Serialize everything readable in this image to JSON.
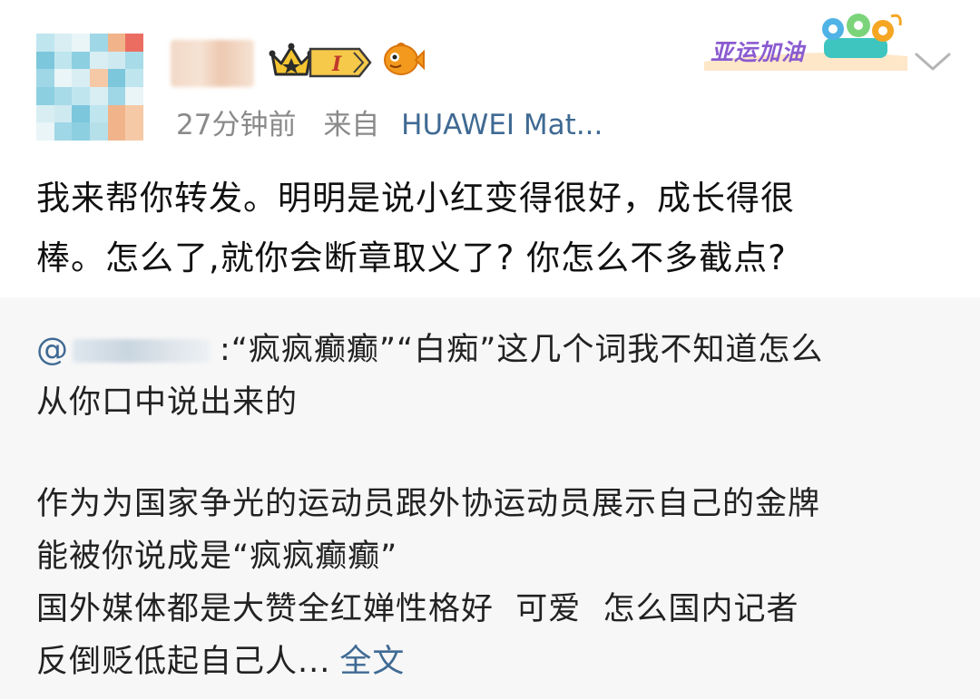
{
  "header": {
    "time_ago": "27分钟前",
    "source_prefix": "来自",
    "device": "HUAWEI Mat...",
    "level_badge": "I",
    "campaign_badge": "亚运加油"
  },
  "post": {
    "line1": "我来帮你转发。明明是说小红变得很好，成长得很",
    "line2": "棒。怎么了,就你会断章取义了? 你怎么不多截点?"
  },
  "repost": {
    "mention_at": "@",
    "quote_line1": ":“疯疯癫癫”“白痴”这几个词我不知道怎么",
    "quote_line2": "从你口中说出来的",
    "para1_line1": "作为为国家争光的运动员跟外协运动员展示自己的金牌",
    "para1_line2": "能被你说成是“疯疯癫癫”",
    "para2_line1": "国外媒体都是大赞全红婵性格好  可爱  怎么国内记者",
    "para2_line2": "反倒贬低起自己人...",
    "full_text_link": "全文"
  },
  "colors": {
    "link_blue": "#3f6a93",
    "meta_gray": "#8a8a8a",
    "repost_bg": "#f7f7f7",
    "campaign_purple": "#8a5bd0"
  },
  "icons": {
    "crown": "crown-icon",
    "level": "level-badge-icon",
    "fish": "fish-icon",
    "chevron": "chevron-down-icon",
    "mascots": "asian-games-mascot-icon"
  }
}
